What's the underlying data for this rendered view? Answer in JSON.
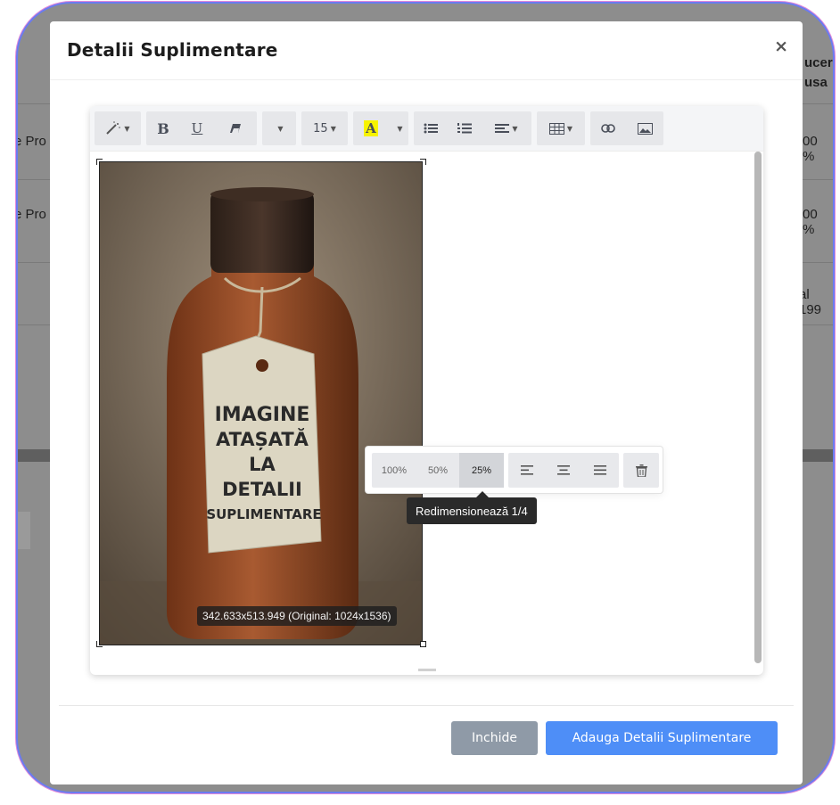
{
  "background": {
    "left_fragments": [
      "e Pro",
      "e Pro"
    ],
    "right_fragments": [
      "ucer",
      "usa",
      "00 %",
      "00 %",
      "al 199"
    ]
  },
  "modal": {
    "title": "Detalii Suplimentare",
    "close_symbol": "×"
  },
  "toolbar": {
    "font_size": "15",
    "bold": "B",
    "underline": "U",
    "color_letter": "A",
    "highlight_color": "#f7f300"
  },
  "image": {
    "tag_text": [
      "IMAGINE",
      "ATAȘATĂ",
      "LA",
      "DETALII",
      "SUPLIMENTARE"
    ],
    "dimension_label": "342.633x513.949 (Original: 1024x1536)"
  },
  "image_toolbar": {
    "sizes": [
      "100%",
      "50%",
      "25%"
    ],
    "active_size": "25%",
    "tooltip": "Redimensionează 1/4"
  },
  "footer": {
    "close_label": "Inchide",
    "add_label": "Adauga Detalii Suplimentare"
  },
  "colors": {
    "primary": "#4e8ef7",
    "secondary": "#8f9aa7"
  }
}
